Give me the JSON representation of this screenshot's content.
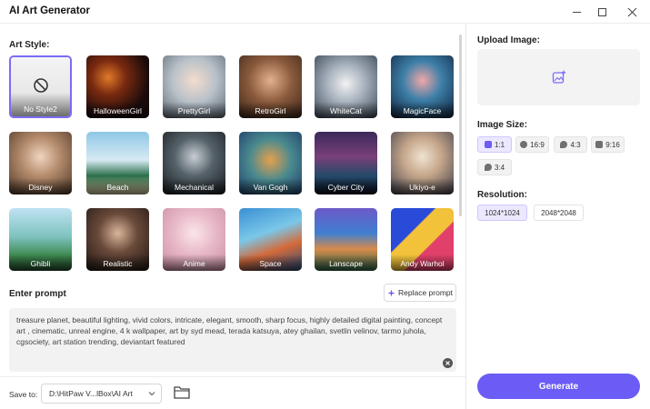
{
  "app": {
    "title": "AI Art Generator"
  },
  "window_controls": {
    "minimize": "minimize-icon",
    "maximize": "maximize-icon",
    "close": "close-icon"
  },
  "art_style": {
    "label": "Art Style:",
    "styles": [
      {
        "name": "No Style2",
        "selected": true
      },
      {
        "name": "HalloweenGirl"
      },
      {
        "name": "PrettyGirl"
      },
      {
        "name": "RetroGirl"
      },
      {
        "name": "WhiteCat"
      },
      {
        "name": "MagicFace"
      },
      {
        "name": "Disney"
      },
      {
        "name": "Beach"
      },
      {
        "name": "Mechanical"
      },
      {
        "name": "Van Gogh"
      },
      {
        "name": "Cyber City"
      },
      {
        "name": "Ukiyo-e"
      },
      {
        "name": "Ghibli"
      },
      {
        "name": "Realistic"
      },
      {
        "name": "Anime"
      },
      {
        "name": "Space"
      },
      {
        "name": "Lanscape"
      },
      {
        "name": "Andy Warhol"
      }
    ]
  },
  "prompt": {
    "label": "Enter prompt",
    "replace_label": "Replace prompt",
    "text": "treasure planet, beautiful lighting, vivid colors, intricate, elegant, smooth, sharp focus, highly detailed digital painting, concept art , cinematic, unreal engine, 4 k wallpaper, art by syd mead, terada katsuya, atey ghailan, svetlin velinov, tarmo juhola, cgsociety, art station trending, deviantart featured"
  },
  "save": {
    "label": "Save to:",
    "path": "D:\\HitPaw V...lBox\\AI Art"
  },
  "upload": {
    "label": "Upload Image:"
  },
  "image_size": {
    "label": "Image Size:",
    "options": [
      {
        "label": "1:1",
        "icon": "instagram-icon",
        "active": true
      },
      {
        "label": "16:9",
        "icon": "facebook-icon"
      },
      {
        "label": "4:3",
        "icon": "twitter-icon"
      },
      {
        "label": "9:16",
        "icon": "instagram-icon"
      },
      {
        "label": "3:4",
        "icon": "twitter-icon"
      }
    ]
  },
  "resolution": {
    "label": "Resolution:",
    "options": [
      {
        "label": "1024*1024",
        "active": true
      },
      {
        "label": "2048*2048"
      }
    ]
  },
  "generate": {
    "label": "Generate"
  },
  "colors": {
    "accent": "#6b5cf5",
    "accent_light": "#ebe8ff"
  }
}
